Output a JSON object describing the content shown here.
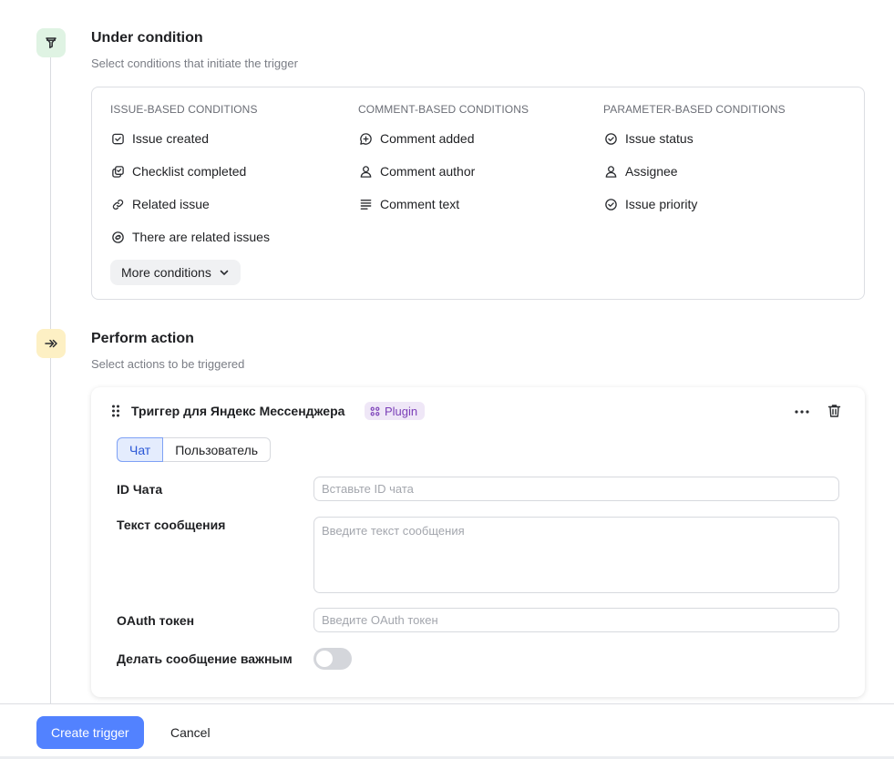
{
  "condition_section": {
    "title": "Under condition",
    "subtitle": "Select conditions that initiate the trigger",
    "icon": "filter-icon",
    "columns": [
      {
        "heading": "ISSUE-BASED CONDITIONS",
        "items": [
          {
            "label": "Issue created",
            "icon": "issue-created-icon"
          },
          {
            "label": "Checklist completed",
            "icon": "checklist-icon"
          },
          {
            "label": "Related issue",
            "icon": "link-icon"
          },
          {
            "label": "There are related issues",
            "icon": "related-issues-icon"
          }
        ]
      },
      {
        "heading": "COMMENT-BASED CONDITIONS",
        "items": [
          {
            "label": "Comment added",
            "icon": "comment-add-icon"
          },
          {
            "label": "Comment author",
            "icon": "person-icon"
          },
          {
            "label": "Comment text",
            "icon": "text-lines-icon"
          }
        ]
      },
      {
        "heading": "PARAMETER-BASED CONDITIONS",
        "items": [
          {
            "label": "Issue status",
            "icon": "check-circle-icon"
          },
          {
            "label": "Assignee",
            "icon": "person-icon"
          },
          {
            "label": "Issue priority",
            "icon": "check-circle-icon"
          }
        ]
      }
    ],
    "more_label": "More conditions"
  },
  "action_section": {
    "title": "Perform action",
    "subtitle": "Select actions to be triggered",
    "icon": "double-arrow-icon",
    "card": {
      "title": "Триггер для Яндекс Мессенджера",
      "badge": "Plugin",
      "tabs": [
        "Чат",
        "Пользователь"
      ],
      "active_tab": "Чат",
      "fields": {
        "chat_id": {
          "label": "ID Чата",
          "placeholder": "Вставьте ID чата",
          "value": ""
        },
        "message": {
          "label": "Текст сообщения",
          "placeholder": "Введите текст сообщения",
          "value": ""
        },
        "oauth": {
          "label": "OAuth токен",
          "placeholder": "Введите OAuth токен",
          "value": ""
        },
        "important": {
          "label": "Делать сообщение важным",
          "enabled": false
        }
      }
    }
  },
  "footer": {
    "create_label": "Create trigger",
    "cancel_label": "Cancel"
  },
  "colors": {
    "primary": "#5282ff",
    "plugin_badge_bg": "#efe7f7",
    "plugin_badge_fg": "#7b3fb8",
    "step_condition_bg": "#dff3e3",
    "step_action_bg": "#fdf0c4"
  }
}
